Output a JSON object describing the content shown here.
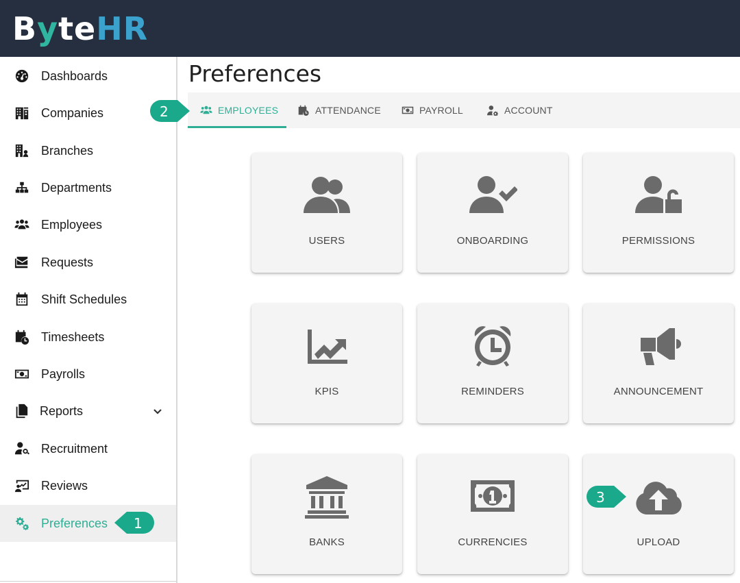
{
  "brand": {
    "logo_part1": "B",
    "logo_part2": "y",
    "logo_part3": "te",
    "logo_part4": "HR"
  },
  "page": {
    "title": "Preferences"
  },
  "sidebar": {
    "items": [
      {
        "label": "Dashboards",
        "icon": "dashboard-gauge-icon"
      },
      {
        "label": "Companies",
        "icon": "building-icon"
      },
      {
        "label": "Branches",
        "icon": "branch-building-icon"
      },
      {
        "label": "Departments",
        "icon": "org-chart-icon"
      },
      {
        "label": "Employees",
        "icon": "users-icon"
      },
      {
        "label": "Requests",
        "icon": "envelope-icon"
      },
      {
        "label": "Shift Schedules",
        "icon": "calendar-icon"
      },
      {
        "label": "Timesheets",
        "icon": "calendar-clock-icon"
      },
      {
        "label": "Payrolls",
        "icon": "money-bill-icon"
      },
      {
        "label": "Reports",
        "icon": "copy-icon"
      },
      {
        "label": "Recruitment",
        "icon": "user-search-icon"
      },
      {
        "label": "Reviews",
        "icon": "chart-board-icon"
      },
      {
        "label": "Preferences",
        "icon": "gears-icon",
        "active": true
      }
    ]
  },
  "tabs": [
    {
      "label": "EMPLOYEES",
      "icon": "users-icon",
      "active": true
    },
    {
      "label": "ATTENDANCE",
      "icon": "calendar-clock-icon"
    },
    {
      "label": "PAYROLL",
      "icon": "money-bill-icon"
    },
    {
      "label": "ACCOUNT",
      "icon": "user-gear-icon"
    }
  ],
  "cards": [
    {
      "label": "USERS",
      "icon": "users-icon"
    },
    {
      "label": "ONBOARDING",
      "icon": "user-check-icon"
    },
    {
      "label": "PERMISSIONS",
      "icon": "user-lock-icon"
    },
    {
      "label": "KPIS",
      "icon": "chart-line-icon"
    },
    {
      "label": "REMINDERS",
      "icon": "alarm-clock-icon"
    },
    {
      "label": "ANNOUNCEMENT",
      "icon": "megaphone-icon"
    },
    {
      "label": "BANKS",
      "icon": "bank-icon"
    },
    {
      "label": "CURRENCIES",
      "icon": "money-bill-icon"
    },
    {
      "label": "UPLOAD",
      "icon": "cloud-upload-icon"
    }
  ],
  "markers": [
    "1",
    "2",
    "3"
  ],
  "colors": {
    "topbar": "#252f3f",
    "accent": "#2eaf95",
    "marker": "#1aa98a",
    "icon_gray": "#6b6b6b"
  }
}
